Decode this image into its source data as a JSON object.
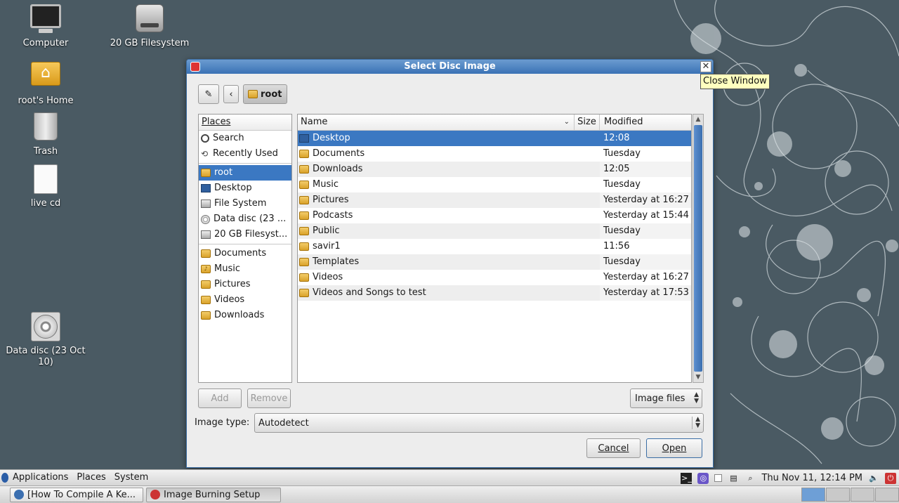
{
  "desktop": {
    "icons": [
      {
        "label": "Computer",
        "icon": "computer-icon"
      },
      {
        "label": "20 GB Filesystem",
        "icon": "harddisk-icon"
      },
      {
        "label": "root's Home",
        "icon": "home-folder-icon"
      },
      {
        "label": "Trash",
        "icon": "trash-icon"
      },
      {
        "label": "live cd",
        "icon": "file-icon"
      },
      {
        "label": "Data disc (23 Oct 10)",
        "icon": "cd-icon"
      }
    ]
  },
  "dialog": {
    "title": "Select Disc Image",
    "close_tooltip": "Close Window",
    "path_current": "root",
    "places_header": "Places",
    "places": [
      {
        "label": "Search",
        "icon": "search-icon"
      },
      {
        "label": "Recently Used",
        "icon": "recent-icon"
      },
      {
        "label": "root",
        "icon": "home-folder-icon",
        "selected": true
      },
      {
        "label": "Desktop",
        "icon": "desktop-icon"
      },
      {
        "label": "File System",
        "icon": "filesystem-icon"
      },
      {
        "label": "Data disc (23 ...",
        "icon": "cd-icon"
      },
      {
        "label": "20 GB Filesyst...",
        "icon": "harddisk-icon"
      },
      {
        "label": "Documents",
        "icon": "folder-icon"
      },
      {
        "label": "Music",
        "icon": "music-folder-icon"
      },
      {
        "label": "Pictures",
        "icon": "pictures-folder-icon"
      },
      {
        "label": "Videos",
        "icon": "videos-folder-icon"
      },
      {
        "label": "Downloads",
        "icon": "downloads-folder-icon"
      }
    ],
    "columns": {
      "name": "Name",
      "size": "Size",
      "modified": "Modified"
    },
    "files": [
      {
        "name": "Desktop",
        "size": "",
        "modified": "12:08",
        "selected": true
      },
      {
        "name": "Documents",
        "size": "",
        "modified": "Tuesday"
      },
      {
        "name": "Downloads",
        "size": "",
        "modified": "12:05"
      },
      {
        "name": "Music",
        "size": "",
        "modified": "Tuesday"
      },
      {
        "name": "Pictures",
        "size": "",
        "modified": "Yesterday at 16:27"
      },
      {
        "name": "Podcasts",
        "size": "",
        "modified": "Yesterday at 15:44"
      },
      {
        "name": "Public",
        "size": "",
        "modified": "Tuesday"
      },
      {
        "name": "savir1",
        "size": "",
        "modified": "11:56"
      },
      {
        "name": "Templates",
        "size": "",
        "modified": "Tuesday"
      },
      {
        "name": "Videos",
        "size": "",
        "modified": "Yesterday at 16:27"
      },
      {
        "name": "Videos and Songs to test",
        "size": "",
        "modified": "Yesterday at 17:53"
      }
    ],
    "add_label": "Add",
    "remove_label": "Remove",
    "filter_value": "Image files",
    "image_type_label": "Image type:",
    "image_type_value": "Autodetect",
    "cancel_label": "Cancel",
    "open_label": "Open"
  },
  "panel": {
    "menus": [
      "Applications",
      "Places",
      "System"
    ],
    "clock": "Thu Nov 11, 12:14 PM"
  },
  "taskbar": {
    "tasks": [
      {
        "label": "[How To Compile A Ke...",
        "active": false
      },
      {
        "label": "Image Burning Setup",
        "active": true
      }
    ]
  },
  "colors": {
    "selection": "#3b78c2",
    "titlebar": "#3a72b5",
    "desktop_bg": "#4a5a63"
  }
}
